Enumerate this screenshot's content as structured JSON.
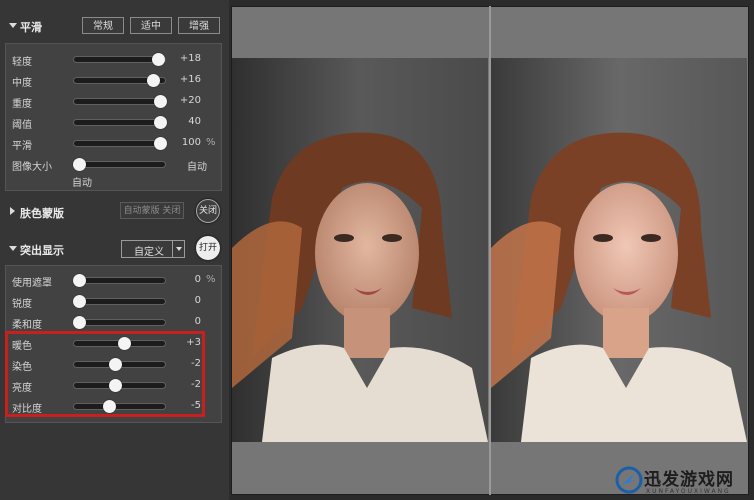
{
  "smooth": {
    "title": "平滑",
    "presets": [
      "常规",
      "适中",
      "增强"
    ],
    "sliders": [
      {
        "label": "轻度",
        "value": "+18",
        "level": 0.92
      },
      {
        "label": "中度",
        "value": "+16",
        "level": 0.87
      },
      {
        "label": "重度",
        "value": "+20",
        "level": 0.95
      },
      {
        "label": "阈值",
        "value": "40",
        "level": 0.95
      },
      {
        "label": "平滑",
        "value": "100",
        "unit": "%",
        "level": 0.95
      }
    ],
    "image_size": {
      "label": "图像大小",
      "value": "自动",
      "sub": "自动",
      "level": 0.05
    }
  },
  "skin_mask": {
    "title": "肤色蒙版",
    "auto_mask": "自动蒙版 关闭",
    "toggle": "关闭"
  },
  "highlight": {
    "title": "突出显示",
    "mode": "自定义",
    "toggle": "打开",
    "sliders": [
      {
        "label": "使用遮罩",
        "value": "0",
        "unit": "%",
        "level": 0.05
      },
      {
        "label": "锐度",
        "value": "0",
        "level": 0.05
      },
      {
        "label": "柔和度",
        "value": "0",
        "level": 0.05
      },
      {
        "label": "暖色",
        "value": "+3",
        "level": 0.55
      },
      {
        "label": "染色",
        "value": "-2",
        "level": 0.45
      },
      {
        "label": "亮度",
        "value": "-2",
        "level": 0.45
      },
      {
        "label": "对比度",
        "value": "-5",
        "level": 0.38
      }
    ]
  },
  "watermark": {
    "main": "迅发游戏网",
    "sub": "XUNFAYOUXIWANG"
  },
  "colors": {
    "accent_red": "#c8201f",
    "panel": "#363636",
    "viewer": "#767676"
  }
}
